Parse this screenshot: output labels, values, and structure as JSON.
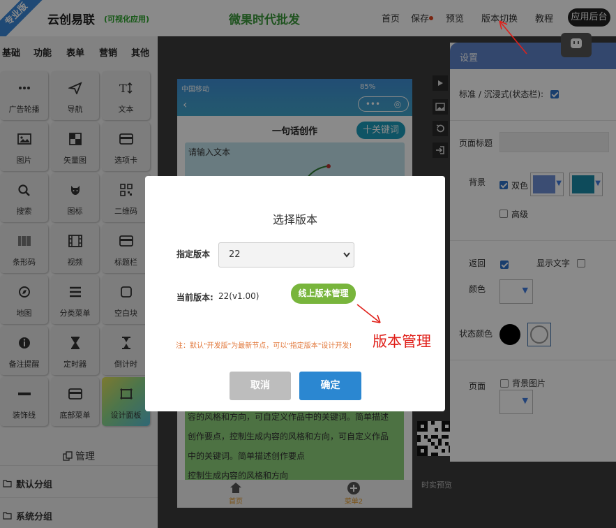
{
  "header": {
    "ribbon": "专业版",
    "logo_name": "云创易联",
    "logo_sub": "(可视化应用)",
    "site_title": "微果时代批发",
    "nav": [
      "首页",
      "保存",
      "预览",
      "版本切换",
      "教程"
    ],
    "admin_button": "应用后台"
  },
  "sidebar": {
    "categories": [
      "基础",
      "功能",
      "表单",
      "营销",
      "其他"
    ],
    "tiles": [
      {
        "label": "广告轮播",
        "icon": "dots-icon"
      },
      {
        "label": "导航",
        "icon": "send-icon"
      },
      {
        "label": "文本",
        "icon": "text-icon"
      },
      {
        "label": "图片",
        "icon": "image-icon"
      },
      {
        "label": "矢量图",
        "icon": "vector-icon"
      },
      {
        "label": "选项卡",
        "icon": "card-icon"
      },
      {
        "label": "搜索",
        "icon": "search-icon"
      },
      {
        "label": "图标",
        "icon": "github-icon"
      },
      {
        "label": "二维码",
        "icon": "qrcode-icon"
      },
      {
        "label": "条形码",
        "icon": "barcode-icon"
      },
      {
        "label": "视频",
        "icon": "film-icon"
      },
      {
        "label": "标题栏",
        "icon": "titlebar-icon"
      },
      {
        "label": "地图",
        "icon": "compass-icon"
      },
      {
        "label": "分类菜单",
        "icon": "menu-icon"
      },
      {
        "label": "空白块",
        "icon": "square-icon"
      },
      {
        "label": "备注提醒",
        "icon": "info-icon"
      },
      {
        "label": "定时器",
        "icon": "hourglass-icon"
      },
      {
        "label": "倒计时",
        "icon": "hourglass-icon"
      },
      {
        "label": "装饰线",
        "icon": "line-icon"
      },
      {
        "label": "底部菜单",
        "icon": "card-icon"
      },
      {
        "label": "设计面板",
        "icon": "frame-icon"
      }
    ],
    "manage_label": "管理",
    "groups": [
      "默认分组",
      "系统分组"
    ]
  },
  "phone": {
    "carrier": "中国移动",
    "battery": "85%",
    "title": "一句话创作",
    "keyword_button": "十关键词",
    "input_placeholder": "请输入文本",
    "body_lines": [
      "容的风格和方向，可自定义作品中的关键词。简单描述",
      "创作要点，控制生成内容的风格和方向，可自定义作品",
      "中的关键词。简单描述创作要点",
      "控制生成内容的风格和方向"
    ],
    "tabs": [
      "首页",
      "菜单2"
    ]
  },
  "qr_label": "时实预览",
  "panel": {
    "title": "设置",
    "status_mode_label": "标准 / 沉浸式(状态栏):",
    "page_title_label": "页面标题",
    "page_title_value": "",
    "background_label": "背景",
    "dual_color_label": "双色",
    "advanced_label": "高级",
    "back_label": "返回",
    "show_text_label": "显示文字",
    "color_label": "颜色",
    "status_color_label": "状态颜色",
    "page_label": "页面",
    "bg_image_label": "背景图片",
    "colors": {
      "swatch1": "#6d8fd4",
      "swatch2": "#1b8ba8"
    }
  },
  "dialog": {
    "title": "选择版本",
    "version_label": "指定版本",
    "version_value": "22",
    "current_label": "当前版本:",
    "current_value": "22(v1.00)",
    "online_button": "线上版本管理",
    "note": "注：默认\"开发版\"为最新节点，可以\"指定版本\"设计开发!",
    "cancel": "取消",
    "ok": "确定"
  },
  "annotation": "版本管理"
}
